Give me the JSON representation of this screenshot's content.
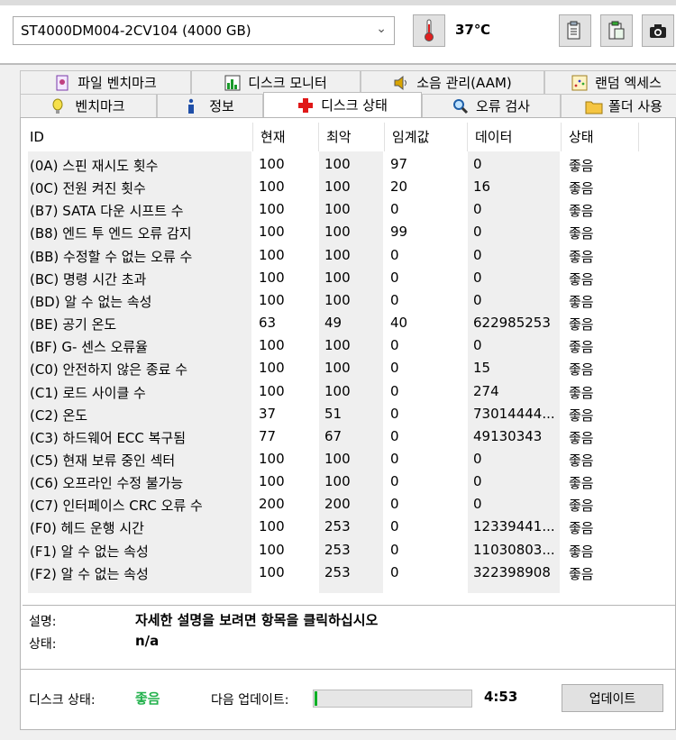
{
  "toolbar": {
    "disk": "ST4000DM004-2CV104 (4000 GB)",
    "temperature": "37℃"
  },
  "tabs_top": [
    {
      "label": "파일 벤치마크",
      "icon": "file-benchmark-icon"
    },
    {
      "label": "디스크 모니터",
      "icon": "disk-monitor-icon"
    },
    {
      "label": "소음 관리(AAM)",
      "icon": "speaker-icon"
    },
    {
      "label": "랜덤 엑세스",
      "icon": "random-access-icon"
    }
  ],
  "tabs_bottom": [
    {
      "label": "벤치마크",
      "icon": "benchmark-icon"
    },
    {
      "label": "정보",
      "icon": "info-icon"
    },
    {
      "label": "디스크 상태",
      "icon": "health-cross-icon"
    },
    {
      "label": "오류 검사",
      "icon": "magnifier-icon"
    },
    {
      "label": "폴더 사용",
      "icon": "folder-icon"
    }
  ],
  "columns": [
    "ID",
    "현재",
    "최악",
    "임계값",
    "데이터",
    "상태"
  ],
  "rows": [
    [
      "(0A) 스핀 재시도 횟수",
      "100",
      "100",
      "97",
      "0",
      "좋음"
    ],
    [
      "(0C) 전원 켜진 횟수",
      "100",
      "100",
      "20",
      "16",
      "좋음"
    ],
    [
      "(B7) SATA 다운 시프트 수",
      "100",
      "100",
      "0",
      "0",
      "좋음"
    ],
    [
      "(B8) 엔드 투 엔드 오류 감지",
      "100",
      "100",
      "99",
      "0",
      "좋음"
    ],
    [
      "(BB) 수정할 수 없는 오류 수",
      "100",
      "100",
      "0",
      "0",
      "좋음"
    ],
    [
      "(BC) 명령 시간 초과",
      "100",
      "100",
      "0",
      "0",
      "좋음"
    ],
    [
      "(BD) 알 수 없는 속성",
      "100",
      "100",
      "0",
      "0",
      "좋음"
    ],
    [
      "(BE) 공기 온도",
      "63",
      "49",
      "40",
      "622985253",
      "좋음"
    ],
    [
      "(BF) G- 센스 오류율",
      "100",
      "100",
      "0",
      "0",
      "좋음"
    ],
    [
      "(C0) 안전하지 않은 종료 수",
      "100",
      "100",
      "0",
      "15",
      "좋음"
    ],
    [
      "(C1) 로드 사이클 수",
      "100",
      "100",
      "0",
      "274",
      "좋음"
    ],
    [
      "(C2) 온도",
      "37",
      "51",
      "0",
      "73014444...",
      "좋음"
    ],
    [
      "(C3) 하드웨어 ECC 복구됨",
      "77",
      "67",
      "0",
      "49130343",
      "좋음"
    ],
    [
      "(C5) 현재 보류 중인 섹터",
      "100",
      "100",
      "0",
      "0",
      "좋음"
    ],
    [
      "(C6) 오프라인 수정 불가능",
      "100",
      "100",
      "0",
      "0",
      "좋음"
    ],
    [
      "(C7) 인터페이스 CRC 오류 수",
      "200",
      "200",
      "0",
      "0",
      "좋음"
    ],
    [
      "(F0) 헤드 운행 시간",
      "100",
      "253",
      "0",
      "12339441...",
      "좋음"
    ],
    [
      "(F1) 알 수 없는 속성",
      "100",
      "253",
      "0",
      "11030803...",
      "좋음"
    ],
    [
      "(F2) 알 수 없는 속성",
      "100",
      "253",
      "0",
      "322398908",
      "좋음"
    ]
  ],
  "info": {
    "desc_label": "설명:",
    "desc_value": "자세한 설명을 보려면 항목을 클릭하십시오",
    "status_label": "상태:",
    "status_value": "n/a"
  },
  "footer": {
    "disk_status_label": "디스크 상태:",
    "disk_status_value": "좋음",
    "next_update_label": "다음 업데이트:",
    "progress_fraction": 0.015,
    "countdown": "4:53",
    "update_button": "업데이트"
  },
  "colors": {
    "good_green": "#22b14c",
    "progress_green": "#06b025",
    "column_shade": "#efefef"
  }
}
